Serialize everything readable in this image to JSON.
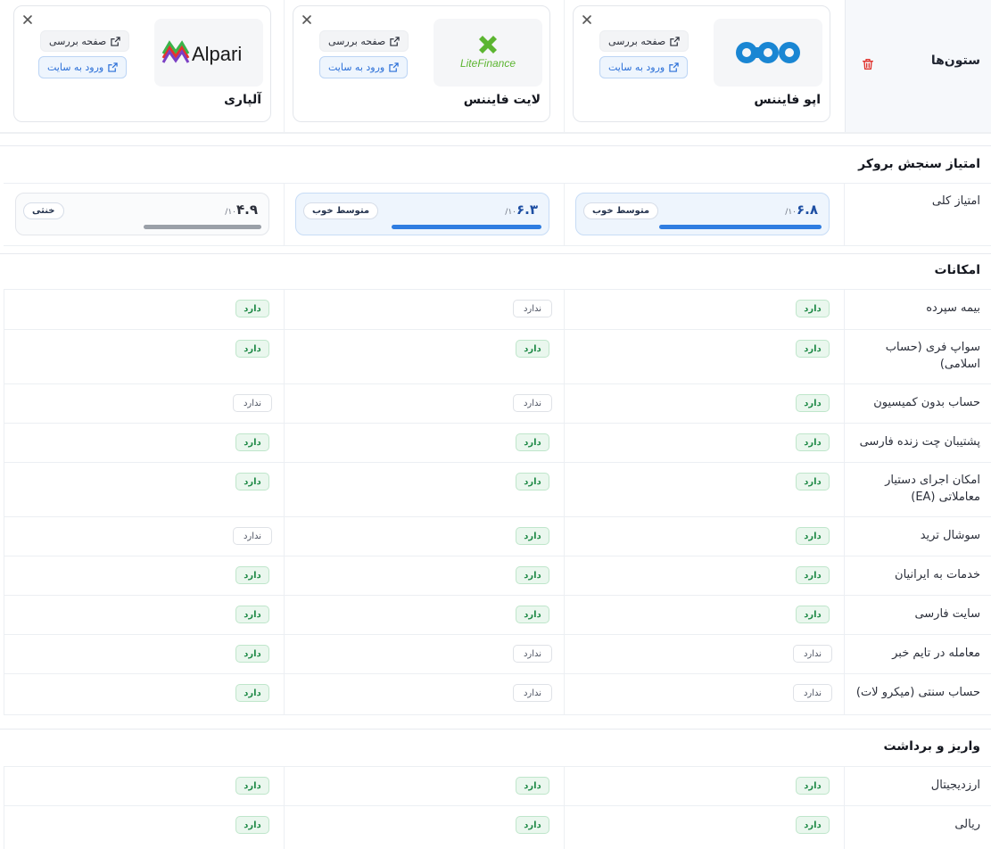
{
  "columns_label": "ستون‌ها",
  "brokers": [
    {
      "name": "اپو فایننس",
      "logo": "opo",
      "review_label": "صفحه بررسی",
      "site_label": "ورود به سایت"
    },
    {
      "name": "لایت فایننس",
      "logo": "LiteFinance",
      "review_label": "صفحه بررسی",
      "site_label": "ورود به سایت"
    },
    {
      "name": "آلپاری",
      "logo": "Alpari",
      "review_label": "صفحه بررسی",
      "site_label": "ورود به سایت"
    }
  ],
  "score_section": {
    "title": "امتیاز سنجش بروکر",
    "row_label": "امتیاز کلی",
    "scores": [
      {
        "value": "۶.۸",
        "max": "/۱۰",
        "badge": "متوسط خوب",
        "fill": 0.68,
        "color": "#2f7de1"
      },
      {
        "value": "۶.۳",
        "max": "/۱۰",
        "badge": "متوسط خوب",
        "fill": 0.63,
        "color": "#2f7de1"
      },
      {
        "value": "۴.۹",
        "max": "/۱۰",
        "badge": "خنثی",
        "fill": 0.49,
        "color": "#9aa0a8"
      }
    ]
  },
  "features_section": {
    "title": "امکانات",
    "rows": [
      {
        "label": "بیمه سپرده",
        "values": [
          "دارد",
          "ندارد",
          "دارد"
        ]
      },
      {
        "label": "سواپ فری (حساب اسلامی)",
        "values": [
          "دارد",
          "دارد",
          "دارد"
        ]
      },
      {
        "label": "حساب بدون کمیسیون",
        "values": [
          "دارد",
          "ندارد",
          "ندارد"
        ]
      },
      {
        "label": "پشتیبان چت زنده فارسی",
        "values": [
          "دارد",
          "دارد",
          "دارد"
        ]
      },
      {
        "label": "امکان اجرای دستیار معاملاتی (EA)",
        "values": [
          "دارد",
          "دارد",
          "دارد"
        ]
      },
      {
        "label": "سوشال ترید",
        "values": [
          "دارد",
          "دارد",
          "ندارد"
        ]
      },
      {
        "label": "خدمات به ایرانیان",
        "values": [
          "دارد",
          "دارد",
          "دارد"
        ]
      },
      {
        "label": "سایت فارسی",
        "values": [
          "دارد",
          "دارد",
          "دارد"
        ]
      },
      {
        "label": "معامله در تایم خبر",
        "values": [
          "ندارد",
          "ندارد",
          "دارد"
        ]
      },
      {
        "label": "حساب سنتی (میکرو لات)",
        "values": [
          "ندارد",
          "ندارد",
          "دارد"
        ]
      }
    ]
  },
  "deposit_section": {
    "title": "واریز و برداشت",
    "rows": [
      {
        "label": "ارزدیجیتال",
        "values": [
          "دارد",
          "دارد",
          "دارد"
        ]
      },
      {
        "label": "ریالی",
        "values": [
          "دارد",
          "دارد",
          "دارد"
        ]
      }
    ]
  },
  "colors": {
    "yes": "#1f8a47",
    "no": "#4b5160",
    "accent": "#2f7de1",
    "delete": "#e0312b"
  }
}
